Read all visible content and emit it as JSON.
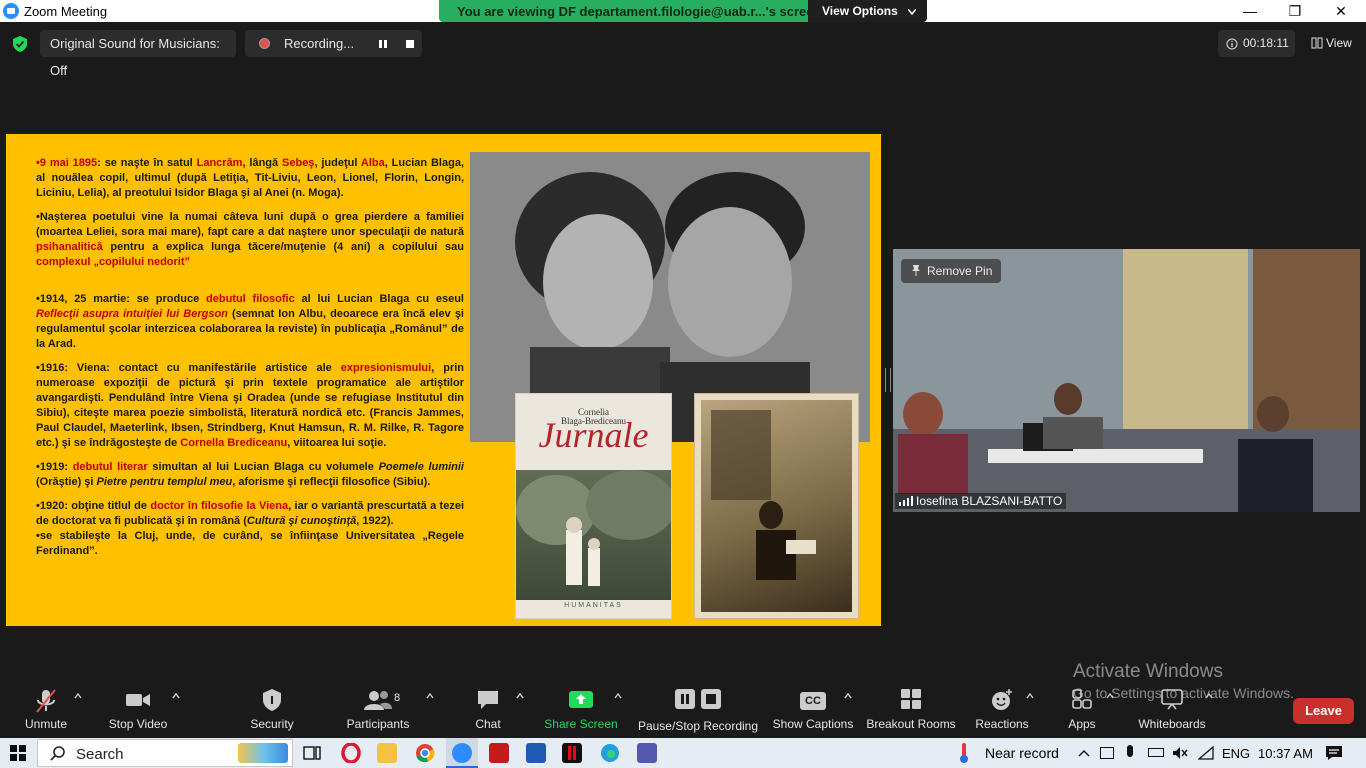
{
  "window": {
    "title": "Zoom Meeting",
    "minimize": "—",
    "restore": "❐",
    "close": "✕"
  },
  "banner": {
    "text": "You are viewing DF departament.filologie@uab.r...'s screen",
    "view_options": "View Options",
    "bg_color": "#27ae60"
  },
  "topbar": {
    "original_sound": "Original Sound for Musicians: Off",
    "recording": "Recording...",
    "timer": "00:18:11",
    "view": "View"
  },
  "slide": {
    "bg_color": "#ffc000",
    "p1": {
      "date": "•9 mai 1895",
      "t1": ": se naşte în satul ",
      "place1": "Lancrăm",
      "t2": ", lângă ",
      "place2": "Sebeş",
      "t3": ", judeţul ",
      "place3": "Alba",
      "t4": ", Lucian Blaga, al nouălea copil, ultimul (după Letiţia, Tit-Liviu, Leon, Lionel, Florin, Longin, Liciniu, Lelia), al preotului Isidor Blaga şi al Anei (n. Moga)."
    },
    "p2": {
      "t1": "•Naşterea poetului vine la numai câteva luni după o grea pierdere a familiei (moartea Leliei, sora mai mare), fapt care a dat naştere unor speculaţii de natură ",
      "hl1": "psihanalitică",
      "t2": " pentru a explica lunga tăcere/muţenie  (4 ani) a copilului sau ",
      "hl2": "complexul „copilului nedorit”"
    },
    "p3": {
      "t1": "•1914, 25 martie: se produce ",
      "hl1": "debutul filosofic",
      "t2": " al lui Lucian Blaga cu eseul ",
      "hl2": "Reflecţii asupra intuiţiei lui Bergson",
      "t3": " (semnat Ion Albu, deoarece era încă elev şi regulamentul şcolar interzicea colaborarea la reviste) în publicaţia „Românul” de la Arad."
    },
    "p4": {
      "t1": "•1916: Viena: contact cu manifestările artistice ale ",
      "hl1": "expresionismului",
      "t2": ", prin numeroase expoziţii de pictură şi prin textele programatice ale artiştilor avangardişti. Pendulând între Viena şi Oradea (unde se refugiase Institutul din Sibiu), citeşte marea poezie simbolistă, literatură nordică etc. (Francis Jammes, Paul Claudel, Maeterlink, Ibsen, Strindberg, Knut Hamsun, R. M. Rilke, R. Tagore etc.) şi se îndrăgosteşte de ",
      "hl2": "Cornella Brediceanu",
      "t3": ", viitoarea lui soţie."
    },
    "p5": {
      "t1": "•1919: ",
      "hl1": "debutul literar",
      "t2": " simultan al lui Lucian Blaga cu volumele ",
      "it1": "Poemele luminii",
      "t3": " (Orăştie) şi ",
      "it2": "Pietre pentru templul meu",
      "t4": ", aforisme şi reflecţii filosofice (Sibiu)."
    },
    "p6": {
      "t1": "•1920: obţine titlul de ",
      "hl1": "doctor în filosofie la Viena",
      "t2": ", iar o variantă prescurtată a tezei de doctorat va fi publicată şi în română (",
      "it1": "Cultură şi cunoştinţă",
      "t3": ", 1922)."
    },
    "p7": "•se stabileşte la Cluj, unde, de curând, se înfiinţase Universitatea „Regele Ferdinand”.",
    "book": {
      "author1": "Cornelia",
      "author2": "Blaga-Brediceanu",
      "title": "Jurnale",
      "publisher": "HUMANITAS"
    }
  },
  "video": {
    "remove_pin": "Remove Pin",
    "participant": "Iosefina BLAZSANI-BATTO"
  },
  "toolbar": {
    "unmute": "Unmute",
    "stop_video": "Stop Video",
    "security": "Security",
    "participants": "Participants",
    "participants_count": "8",
    "chat": "Chat",
    "share_screen": "Share Screen",
    "pause_stop": "Pause/Stop Recording",
    "captions": "Show Captions",
    "captions_badge": "CC",
    "breakout": "Breakout Rooms",
    "reactions": "Reactions",
    "apps": "Apps",
    "whiteboards": "Whiteboards",
    "leave": "Leave",
    "leave_color": "#c9302c",
    "share_color": "#23d959"
  },
  "watermark": {
    "line1": "Activate Windows",
    "line2": "Go to Settings to activate Windows."
  },
  "taskbar": {
    "search": "Search",
    "near_record": "Near record",
    "lang": "ENG",
    "time": "10:37 AM"
  }
}
